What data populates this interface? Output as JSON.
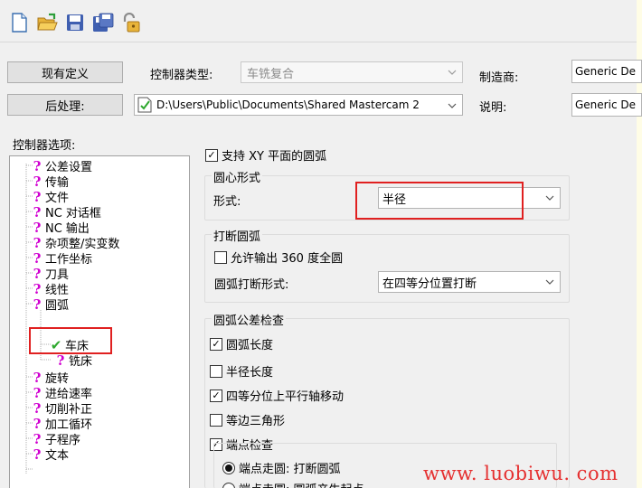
{
  "toolbar": {
    "buttons": [
      {
        "icon": "new-file-icon"
      },
      {
        "icon": "open-folder-icon"
      },
      {
        "icon": "save-icon"
      },
      {
        "icon": "save-as-icon"
      },
      {
        "icon": "lock-icon"
      }
    ]
  },
  "form": {
    "existing_def_button": "现有定义",
    "controller_type_label": "控制器类型:",
    "controller_type_value": "车铣复合",
    "manufacturer_label": "制造商:",
    "manufacturer_value": "Generic De",
    "post_button": "后处理:",
    "post_path": "D:\\Users\\Public\\Documents\\Shared Mastercam 2",
    "description_label": "说明:",
    "description_value": "Generic De"
  },
  "tree": {
    "title": "控制器选项:",
    "items": [
      {
        "label": "公差设置",
        "state": "unknown"
      },
      {
        "label": "传输",
        "state": "unknown"
      },
      {
        "label": "文件",
        "state": "unknown"
      },
      {
        "label": "NC 对话框",
        "state": "unknown"
      },
      {
        "label": "NC 输出",
        "state": "unknown"
      },
      {
        "label": "杂项整/实变数",
        "state": "unknown"
      },
      {
        "label": "工作坐标",
        "state": "unknown"
      },
      {
        "label": "刀具",
        "state": "unknown"
      },
      {
        "label": "线性",
        "state": "unknown"
      },
      {
        "label": "圆弧",
        "state": "unknown"
      },
      {
        "label": "车床",
        "state": "done"
      },
      {
        "label": "铣床",
        "state": "unknown"
      },
      {
        "label": "旋转",
        "state": "unknown"
      },
      {
        "label": "进给速率",
        "state": "unknown"
      },
      {
        "label": "切削补正",
        "state": "unknown"
      },
      {
        "label": "加工循环",
        "state": "unknown"
      },
      {
        "label": "子程序",
        "state": "unknown"
      },
      {
        "label": "文本",
        "state": "unknown"
      }
    ]
  },
  "panel": {
    "support_xy_arc": {
      "label": "支持 XY 平面的圆弧",
      "checked": true
    },
    "center_group": {
      "title": "圆心形式",
      "form_label": "形式:",
      "form_value": "半径"
    },
    "break_group": {
      "title": "打断圆弧",
      "allow_360": {
        "label": "允许输出 360 度全圆",
        "checked": false
      },
      "break_form_label": "圆弧打断形式:",
      "break_form_value": "在四等分位置打断"
    },
    "tolerance_group": {
      "title": "圆弧公差检查",
      "arc_length": {
        "label": "圆弧长度",
        "checked": true
      },
      "radius_length": {
        "label": "半径长度",
        "checked": false
      },
      "quadrant_move": {
        "label": "四等分位上平行轴移动",
        "checked": true
      },
      "equilateral": {
        "label": "等边三角形",
        "checked": false
      },
      "endpoint_check": {
        "label": "端点检查",
        "checked": true
      },
      "radio_break": {
        "label": "端点走圆: 打断圆弧",
        "selected": true
      },
      "radio_generate": {
        "label": "端点走圆: 圆弧产生起点",
        "selected": false
      }
    }
  },
  "watermark": "www. luobiwu. com",
  "colors": {
    "highlight": "#e02020",
    "unknown_icon": "#d000d0",
    "done_icon": "#2ea82e"
  }
}
